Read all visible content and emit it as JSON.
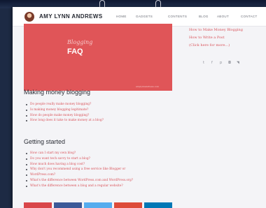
{
  "header": {
    "brand": "AMY LYNN ANDREWS",
    "nav": [
      "HOME",
      "GADGETS",
      "CONTENTS",
      "BLOG",
      "ABOUT",
      "CONTACT"
    ]
  },
  "hero": {
    "subtitle": "Blogging",
    "title": "FAQ",
    "footer": "amylynnandrews.com"
  },
  "sidebar": {
    "links": [
      "How to Make Money Blogging",
      "How to Write a Post",
      "(Click here for more...)"
    ],
    "social_icons": [
      "twitter-icon",
      "facebook-icon",
      "pinterest-icon",
      "instagram-icon",
      "rss-icon"
    ]
  },
  "sections": [
    {
      "heading": "Making money blogging",
      "items": [
        "Do people really make money blogging?",
        "Is making money blogging legitimate?",
        "How do people make money blogging?",
        "How long does it take to make money at a blog?"
      ]
    },
    {
      "heading": "Getting started",
      "items": [
        "How can I start my own blog?",
        "Do you want tech savvy to start a blog?",
        "How much does having a blog cost?",
        "Why don't you recommend using a free service like Blogger or",
        "WordPress.com?",
        "What's the difference between WordPress.com and WordPress.org?",
        "What's the difference between a blog and a regular website?"
      ]
    }
  ],
  "share_colors": [
    "#d9464a",
    "#3b5998",
    "#55acee",
    "#dd4b39",
    "#0077b5"
  ]
}
